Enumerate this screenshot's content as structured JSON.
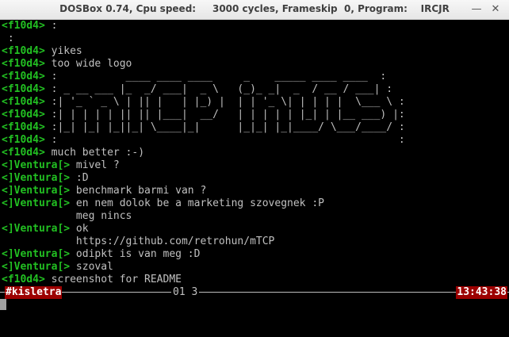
{
  "window": {
    "title": "DOSBox 0.74, Cpu speed:     3000 cycles, Frameskip  0, Program:    IRCJR",
    "minimize_icon": "minimize-icon",
    "close_icon": "close-icon"
  },
  "chat": [
    {
      "nick": "<f10d4>",
      "text": " :"
    },
    {
      "nick": "",
      "text": " :"
    },
    {
      "nick": "<f10d4>",
      "text": " yikes"
    },
    {
      "nick": "<f10d4>",
      "text": " too wide logo"
    },
    {
      "nick": "<f10d4>",
      "text": " :           ____ ____ ____     _    _____ ____ ____  :"
    },
    {
      "nick": "<f10d4>",
      "text": " : _ __ ___ |_  _/ ___|  _ \\   (_)_ _|  _  / __ / ___| :"
    },
    {
      "nick": "<f10d4>",
      "text": " :| '_ ` _ \\ | || |   | |_) |  | | '_ \\| | | | |  \\___ \\ :"
    },
    {
      "nick": "<f10d4>",
      "text": " :| | | | | || || |___|  __/   | | | | | |_| | |__ ___) |:"
    },
    {
      "nick": "<f10d4>",
      "text": " :|_| |_| |_||_| \\____|_|      |_|_| |_|____/ \\___/____/ :"
    },
    {
      "nick": "<f10d4>",
      "text": " :                                                       :"
    },
    {
      "nick": "<f10d4>",
      "text": " much better :-)"
    },
    {
      "nick": "<]Ventura[>",
      "text": " mivel ?"
    },
    {
      "nick": "<]Ventura[>",
      "text": " :D"
    },
    {
      "nick": "<]Ventura[>",
      "text": " benchmark barmi van ?"
    },
    {
      "nick": "<]Ventura[>",
      "text": " en nem dolok be a marketing szovegnek :P"
    },
    {
      "nick": "",
      "text": "            meg nincs"
    },
    {
      "nick": "<]Ventura[>",
      "text": " ok"
    },
    {
      "nick": "",
      "text": "            https://github.com/retrohun/mTCP"
    },
    {
      "nick": "<]Ventura[>",
      "text": " odipkt is van meg :D"
    },
    {
      "nick": "<]Ventura[>",
      "text": " szoval"
    },
    {
      "nick": "<f10d4>",
      "text": " screenshot for README"
    }
  ],
  "status": {
    "channel": "#kisletra",
    "counts": "01 3",
    "clock": "13:43:38"
  },
  "colors": {
    "nick": "#22c022",
    "text": "#c0c0c0",
    "status_highlight": "#9c0000",
    "background": "#000000"
  }
}
